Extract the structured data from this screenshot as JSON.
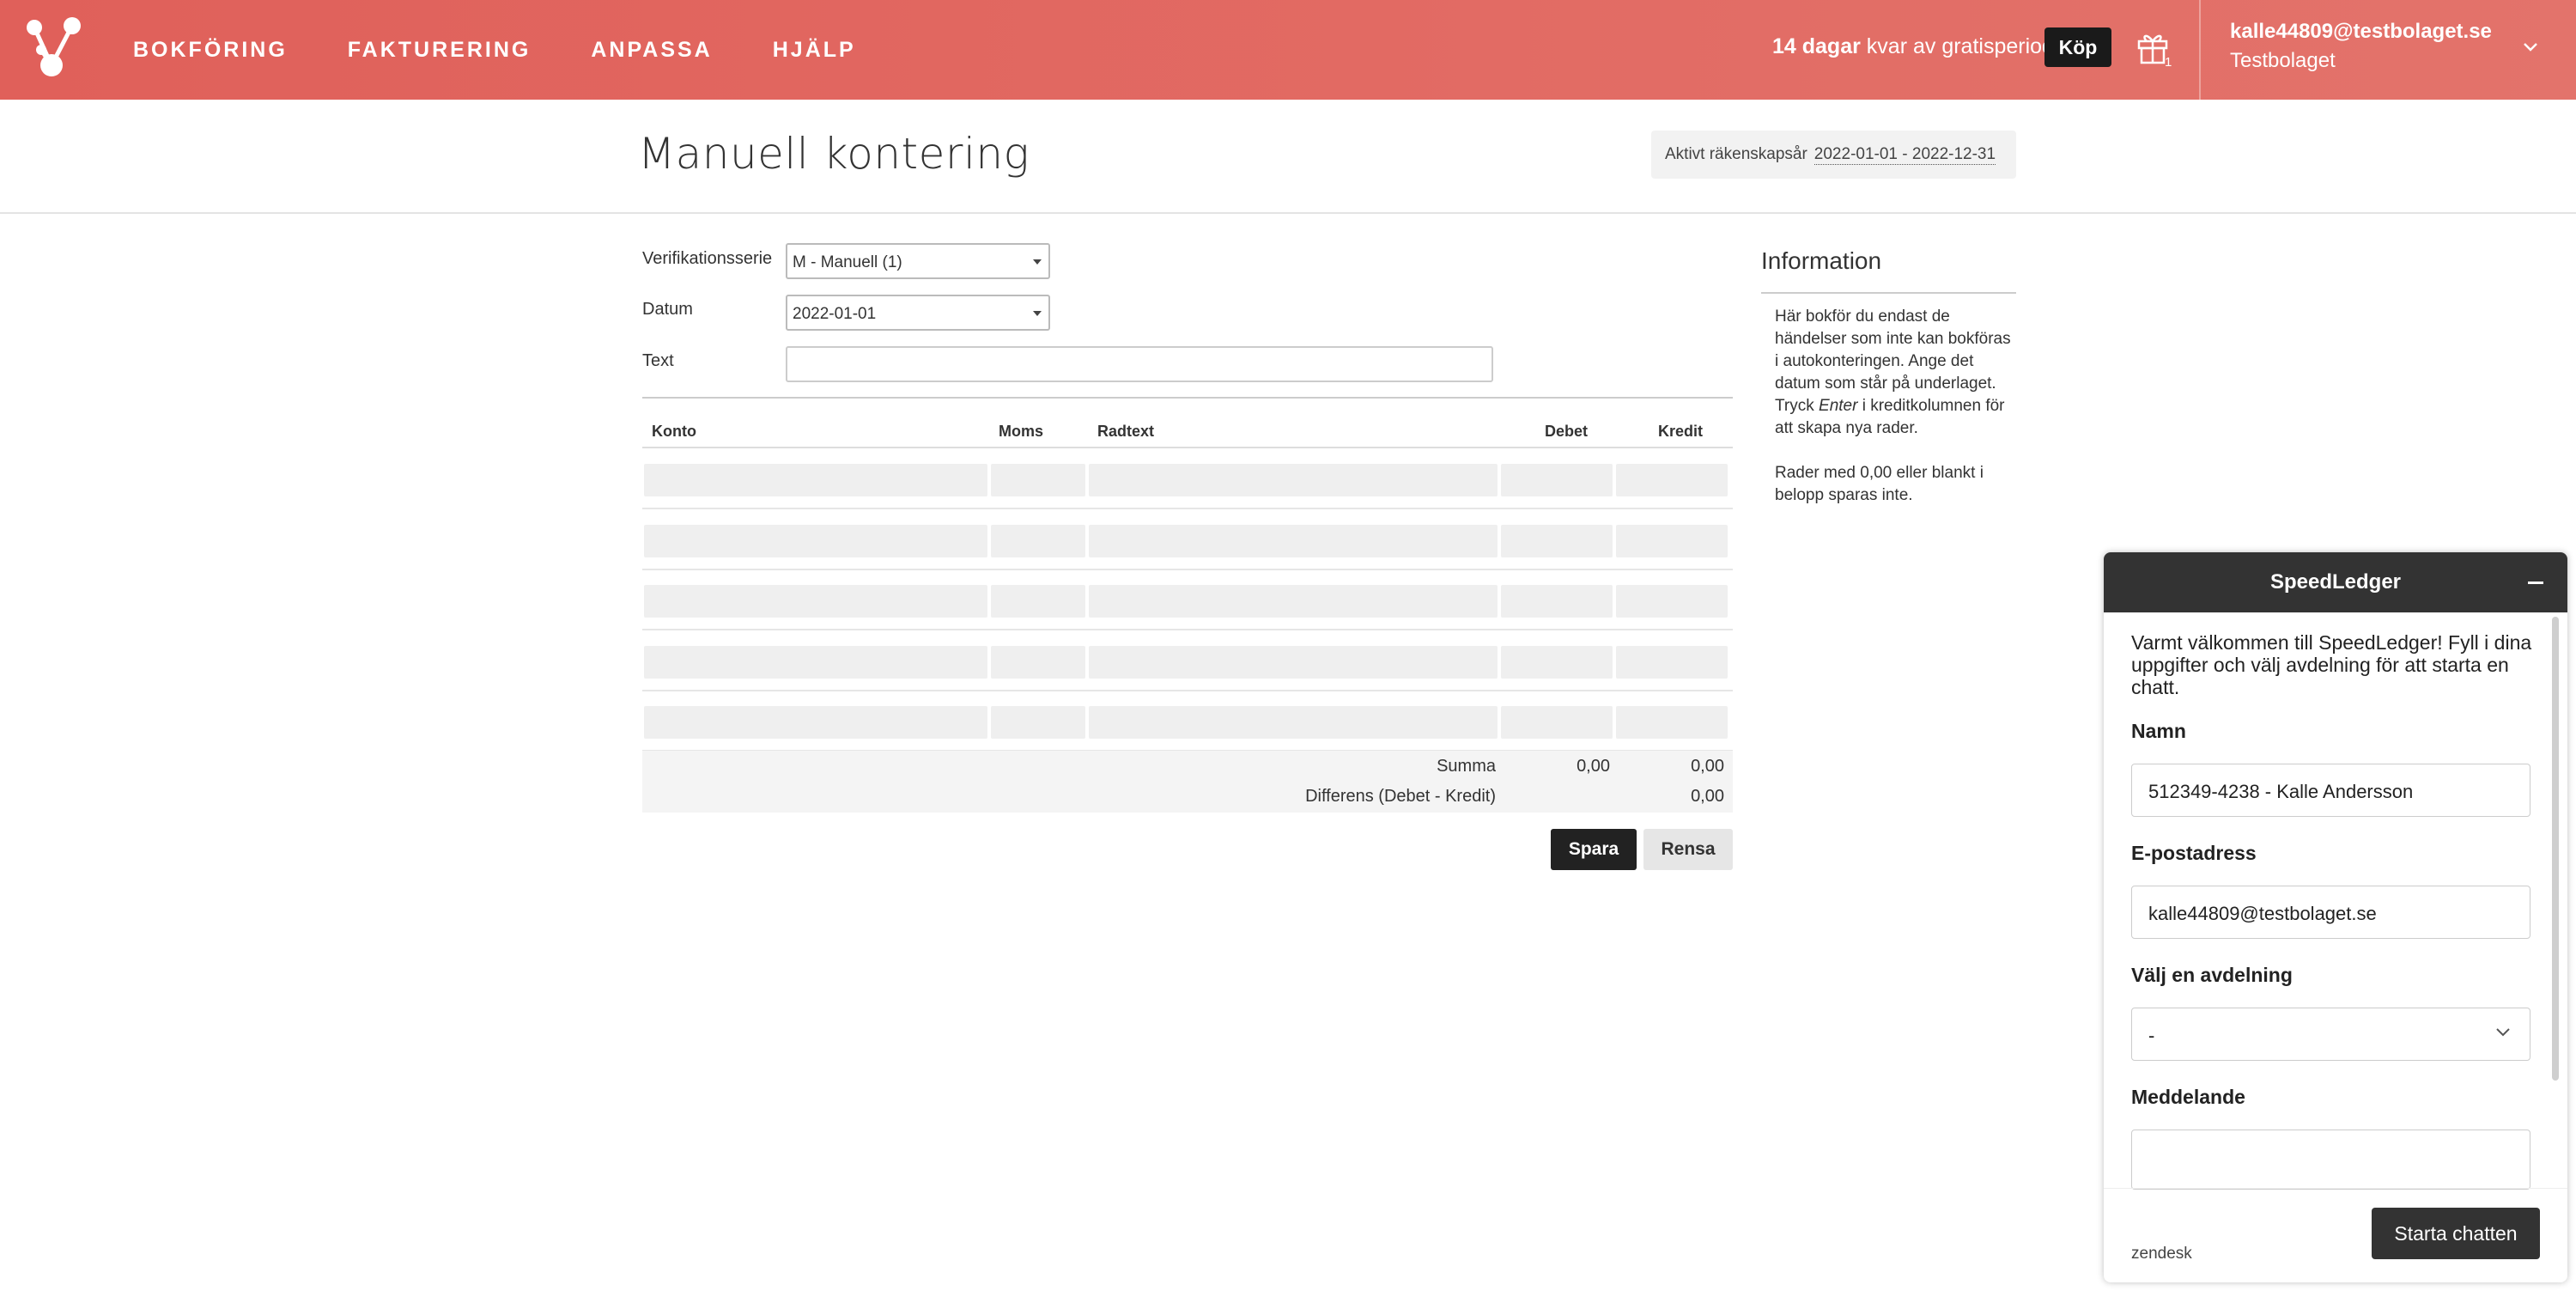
{
  "nav": {
    "items": [
      "BOKFÖRING",
      "FAKTURERING",
      "ANPASSA",
      "HJÄLP"
    ],
    "trial_bold": "14 dagar",
    "trial_rest": "kvar av gratisperiod",
    "buy_label": "Köp",
    "gift_count": "1",
    "account_email": "kalle44809@testbolaget.se",
    "account_company": "Testbolaget"
  },
  "page": {
    "title": "Manuell kontering",
    "fiscal_label": "Aktivt räkenskapsår",
    "fiscal_range": "2022-01-01 - 2022-12-31"
  },
  "form": {
    "series_label": "Verifikationsserie",
    "series_value": "M - Manuell (1)",
    "date_label": "Datum",
    "date_value": "2022-01-01",
    "text_label": "Text",
    "text_value": ""
  },
  "table": {
    "headers": {
      "konto": "Konto",
      "moms": "Moms",
      "radtext": "Radtext",
      "debet": "Debet",
      "kredit": "Kredit"
    },
    "rows": [
      {},
      {},
      {},
      {},
      {}
    ],
    "summa_label": "Summa",
    "summa_debet": "0,00",
    "summa_kredit": "0,00",
    "diff_label": "Differens (Debet - Kredit)",
    "diff_value": "0,00"
  },
  "buttons": {
    "save": "Spara",
    "clear": "Rensa"
  },
  "info": {
    "title": "Information",
    "p1_a": "Här bokför du endast de händelser som inte kan bokföras i autokonteringen. Ange det datum som står på underlaget. Tryck ",
    "p1_em": "Enter",
    "p1_b": " i kreditkolumnen för att skapa nya rader.",
    "p2": "Rader med 0,00 eller blankt i belopp sparas inte."
  },
  "chat": {
    "title": "SpeedLedger",
    "welcome": "Varmt välkommen till SpeedLedger! Fyll i dina uppgifter och välj avdelning för att starta en chatt.",
    "name_label": "Namn",
    "name_value": "512349-4238 - Kalle Andersson",
    "email_label": "E-postadress",
    "email_value": "kalle44809@testbolaget.se",
    "dept_label": "Välj en avdelning",
    "dept_value": "-",
    "message_label": "Meddelande",
    "brand": "zendesk",
    "start_label": "Starta chatten"
  },
  "colors": {
    "topbar": "#e0605a",
    "dark": "#222222"
  }
}
